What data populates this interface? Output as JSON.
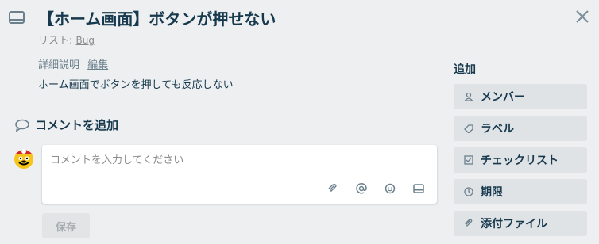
{
  "card": {
    "title": "【ホーム画面】ボタンが押せない",
    "list_prefix": "リスト: ",
    "list_name": "Bug"
  },
  "description": {
    "label": "詳細説明",
    "edit_link": "編集",
    "text": "ホーム画面でボタンを押しても反応しない"
  },
  "comment": {
    "heading": "コメントを追加",
    "placeholder": "コメントを入力してください",
    "save_label": "保存",
    "tools": [
      "paperclip-icon",
      "mention-icon",
      "emoji-icon",
      "card-icon"
    ]
  },
  "sidebar": {
    "title": "追加",
    "buttons": [
      {
        "label": "メンバー",
        "icon": "member-icon"
      },
      {
        "label": "ラベル",
        "icon": "label-icon"
      },
      {
        "label": "チェックリスト",
        "icon": "checklist-icon"
      },
      {
        "label": "期限",
        "icon": "clock-icon"
      },
      {
        "label": "添付ファイル",
        "icon": "attachment-icon"
      }
    ]
  }
}
